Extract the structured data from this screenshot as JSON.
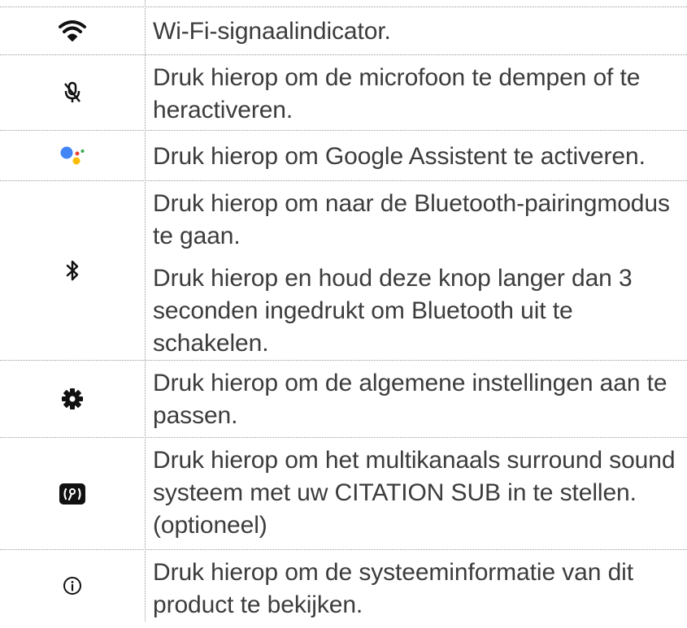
{
  "rows": [
    {
      "icon": "wifi-icon",
      "lines": [
        "Wi-Fi-signaalindicator."
      ]
    },
    {
      "icon": "microphone-mute-icon",
      "lines": [
        "Druk hierop om de microfoon te dempen of te heractiveren."
      ]
    },
    {
      "icon": "google-assistant-icon",
      "lines": [
        "Druk hierop om Google Assistent te activeren."
      ]
    },
    {
      "icon": "bluetooth-icon",
      "lines": [
        "Druk hierop om naar de Bluetooth-pairingmodus te gaan.",
        "Druk hierop en houd deze knop langer dan 3 seconden ingedrukt om Bluetooth uit te schakelen."
      ]
    },
    {
      "icon": "gear-icon",
      "lines": [
        "Druk hierop om de algemene instellingen aan te passen."
      ]
    },
    {
      "icon": "surround-sound-icon",
      "lines": [
        "Druk hierop om het multikanaals surround sound systeem met uw CITATION SUB in te stellen. (optioneel)"
      ]
    },
    {
      "icon": "info-icon",
      "lines": [
        "Druk hierop om de systeeminformatie van dit product te bekijken."
      ]
    }
  ],
  "colors": {
    "text": "#3c3c3c",
    "icon": "#111111",
    "google_blue": "#4285F4",
    "google_red": "#EA4335",
    "google_yellow": "#FBBC05",
    "google_green": "#34A853"
  }
}
